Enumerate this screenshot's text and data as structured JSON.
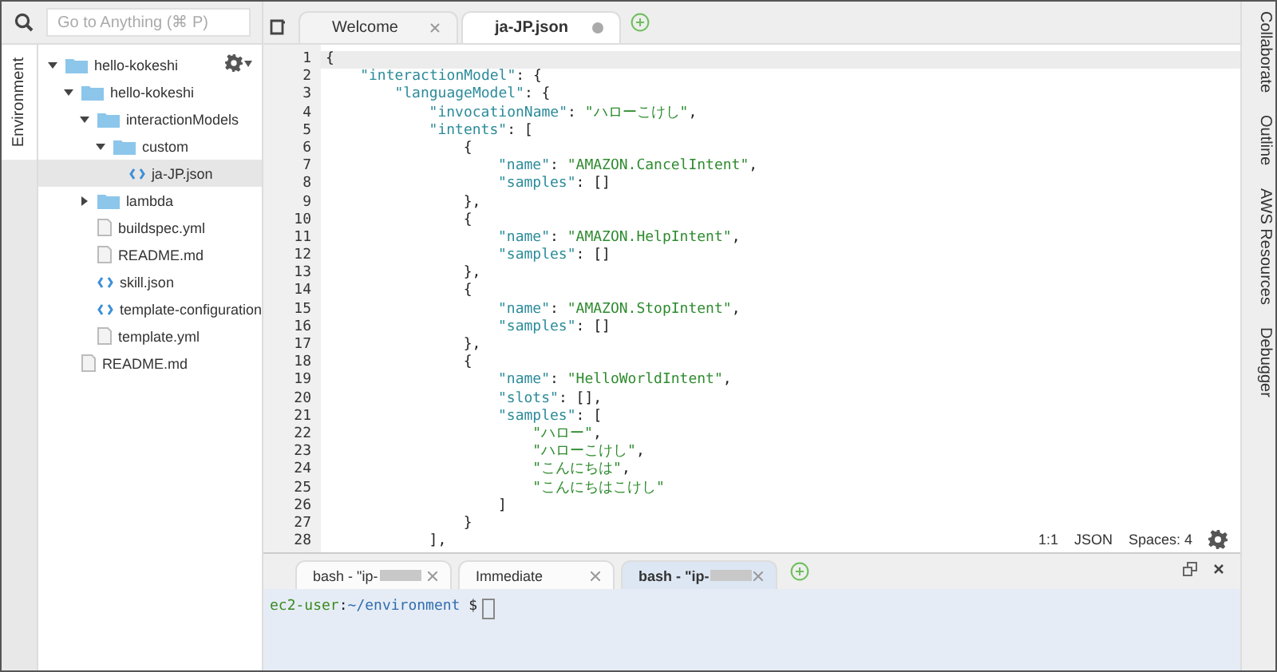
{
  "search": {
    "placeholder": "Go to Anything (⌘ P)"
  },
  "left_tabs": [
    {
      "label": "Environment",
      "selected": true
    }
  ],
  "tree": [
    {
      "label": "hello-kokeshi",
      "kind": "folder",
      "expanded": true,
      "selected": false,
      "children": [
        {
          "label": "hello-kokeshi",
          "kind": "folder",
          "expanded": true,
          "selected": false,
          "children": [
            {
              "label": "interactionModels",
              "kind": "folder",
              "expanded": true,
              "selected": false,
              "children": [
                {
                  "label": "custom",
                  "kind": "folder",
                  "expanded": true,
                  "selected": false,
                  "children": [
                    {
                      "label": "ja-JP.json",
                      "kind": "json",
                      "selected": true
                    }
                  ]
                }
              ]
            },
            {
              "label": "lambda",
              "kind": "folder",
              "expanded": false,
              "selected": false
            },
            {
              "label": "buildspec.yml",
              "kind": "file",
              "selected": false
            },
            {
              "label": "README.md",
              "kind": "file",
              "selected": false
            },
            {
              "label": "skill.json",
              "kind": "json",
              "selected": false
            },
            {
              "label": "template-configuration",
              "kind": "json",
              "selected": false
            },
            {
              "label": "template.yml",
              "kind": "file",
              "selected": false
            }
          ]
        },
        {
          "label": "README.md",
          "kind": "file",
          "selected": false
        }
      ]
    }
  ],
  "editor_tabs": [
    {
      "label": "Welcome",
      "selected": false,
      "modified": false
    },
    {
      "label": "ja-JP.json",
      "selected": true,
      "modified": true
    }
  ],
  "code": [
    {
      "n": "1",
      "tokens": [
        {
          "kind": "punct",
          "text": "{"
        }
      ]
    },
    {
      "n": "2",
      "tokens": [
        {
          "kind": "key",
          "text": "\"interactionModel\""
        },
        {
          "kind": "punct",
          "text": ": {"
        }
      ]
    },
    {
      "n": "3",
      "tokens": [
        {
          "kind": "key",
          "text": "\"languageModel\""
        },
        {
          "kind": "punct",
          "text": ": {"
        }
      ]
    },
    {
      "n": "4",
      "tokens": [
        {
          "kind": "key",
          "text": "\"invocationName\""
        },
        {
          "kind": "punct",
          "text": ": "
        },
        {
          "kind": "string",
          "text": "\"ハローこけし\""
        },
        {
          "kind": "punct",
          "text": ","
        }
      ]
    },
    {
      "n": "5",
      "tokens": [
        {
          "kind": "key",
          "text": "\"intents\""
        },
        {
          "kind": "punct",
          "text": ": ["
        }
      ]
    },
    {
      "n": "6",
      "tokens": [
        {
          "kind": "punct",
          "text": "{"
        }
      ]
    },
    {
      "n": "7",
      "tokens": [
        {
          "kind": "key",
          "text": "\"name\""
        },
        {
          "kind": "punct",
          "text": ": "
        },
        {
          "kind": "string",
          "text": "\"AMAZON.CancelIntent\""
        },
        {
          "kind": "punct",
          "text": ","
        }
      ]
    },
    {
      "n": "8",
      "tokens": [
        {
          "kind": "key",
          "text": "\"samples\""
        },
        {
          "kind": "punct",
          "text": ": []"
        }
      ]
    },
    {
      "n": "9",
      "tokens": [
        {
          "kind": "punct",
          "text": "},"
        }
      ]
    },
    {
      "n": "10",
      "tokens": [
        {
          "kind": "punct",
          "text": "{"
        }
      ]
    },
    {
      "n": "11",
      "tokens": [
        {
          "kind": "key",
          "text": "\"name\""
        },
        {
          "kind": "punct",
          "text": ": "
        },
        {
          "kind": "string",
          "text": "\"AMAZON.HelpIntent\""
        },
        {
          "kind": "punct",
          "text": ","
        }
      ]
    },
    {
      "n": "12",
      "tokens": [
        {
          "kind": "key",
          "text": "\"samples\""
        },
        {
          "kind": "punct",
          "text": ": []"
        }
      ]
    },
    {
      "n": "13",
      "tokens": [
        {
          "kind": "punct",
          "text": "},"
        }
      ]
    },
    {
      "n": "14",
      "tokens": [
        {
          "kind": "punct",
          "text": "{"
        }
      ]
    },
    {
      "n": "15",
      "tokens": [
        {
          "kind": "key",
          "text": "\"name\""
        },
        {
          "kind": "punct",
          "text": ": "
        },
        {
          "kind": "string",
          "text": "\"AMAZON.StopIntent\""
        },
        {
          "kind": "punct",
          "text": ","
        }
      ]
    },
    {
      "n": "16",
      "tokens": [
        {
          "kind": "key",
          "text": "\"samples\""
        },
        {
          "kind": "punct",
          "text": ": []"
        }
      ]
    },
    {
      "n": "17",
      "tokens": [
        {
          "kind": "punct",
          "text": "},"
        }
      ]
    },
    {
      "n": "18",
      "tokens": [
        {
          "kind": "punct",
          "text": "{"
        }
      ]
    },
    {
      "n": "19",
      "tokens": [
        {
          "kind": "key",
          "text": "\"name\""
        },
        {
          "kind": "punct",
          "text": ": "
        },
        {
          "kind": "string",
          "text": "\"HelloWorldIntent\""
        },
        {
          "kind": "punct",
          "text": ","
        }
      ]
    },
    {
      "n": "20",
      "tokens": [
        {
          "kind": "key",
          "text": "\"slots\""
        },
        {
          "kind": "punct",
          "text": ": [],"
        }
      ]
    },
    {
      "n": "21",
      "tokens": [
        {
          "kind": "key",
          "text": "\"samples\""
        },
        {
          "kind": "punct",
          "text": ": ["
        }
      ]
    },
    {
      "n": "22",
      "tokens": [
        {
          "kind": "string",
          "text": "\"ハロー\""
        },
        {
          "kind": "punct",
          "text": ","
        }
      ]
    },
    {
      "n": "23",
      "tokens": [
        {
          "kind": "string",
          "text": "\"ハローこけし\""
        },
        {
          "kind": "punct",
          "text": ","
        }
      ]
    },
    {
      "n": "24",
      "tokens": [
        {
          "kind": "string",
          "text": "\"こんにちは\""
        },
        {
          "kind": "punct",
          "text": ","
        }
      ]
    },
    {
      "n": "25",
      "tokens": [
        {
          "kind": "string",
          "text": "\"こんにちはこけし\""
        }
      ]
    },
    {
      "n": "26",
      "tokens": [
        {
          "kind": "punct",
          "text": "]"
        }
      ]
    },
    {
      "n": "27",
      "tokens": [
        {
          "kind": "punct",
          "text": "}"
        }
      ]
    },
    {
      "n": "28",
      "tokens": [
        {
          "kind": "punct",
          "text": "],"
        }
      ]
    }
  ],
  "status": {
    "position": "1:1",
    "mode": "JSON",
    "spaces": "Spaces: 4"
  },
  "terminal_tabs": [
    {
      "label": "bash - \"ip-",
      "redacted": true,
      "selected": false
    },
    {
      "label": "Immediate",
      "redacted": false,
      "selected": false
    },
    {
      "label": "bash - \"ip-",
      "redacted": true,
      "selected": true
    }
  ],
  "terminal": {
    "user": "ec2-user",
    "sep": ":",
    "path": "~/environment",
    "prompt": " $"
  },
  "right_tabs": [
    {
      "label": "Collaborate"
    },
    {
      "label": "Outline"
    },
    {
      "label": "AWS Resources"
    },
    {
      "label": "Debugger"
    }
  ]
}
